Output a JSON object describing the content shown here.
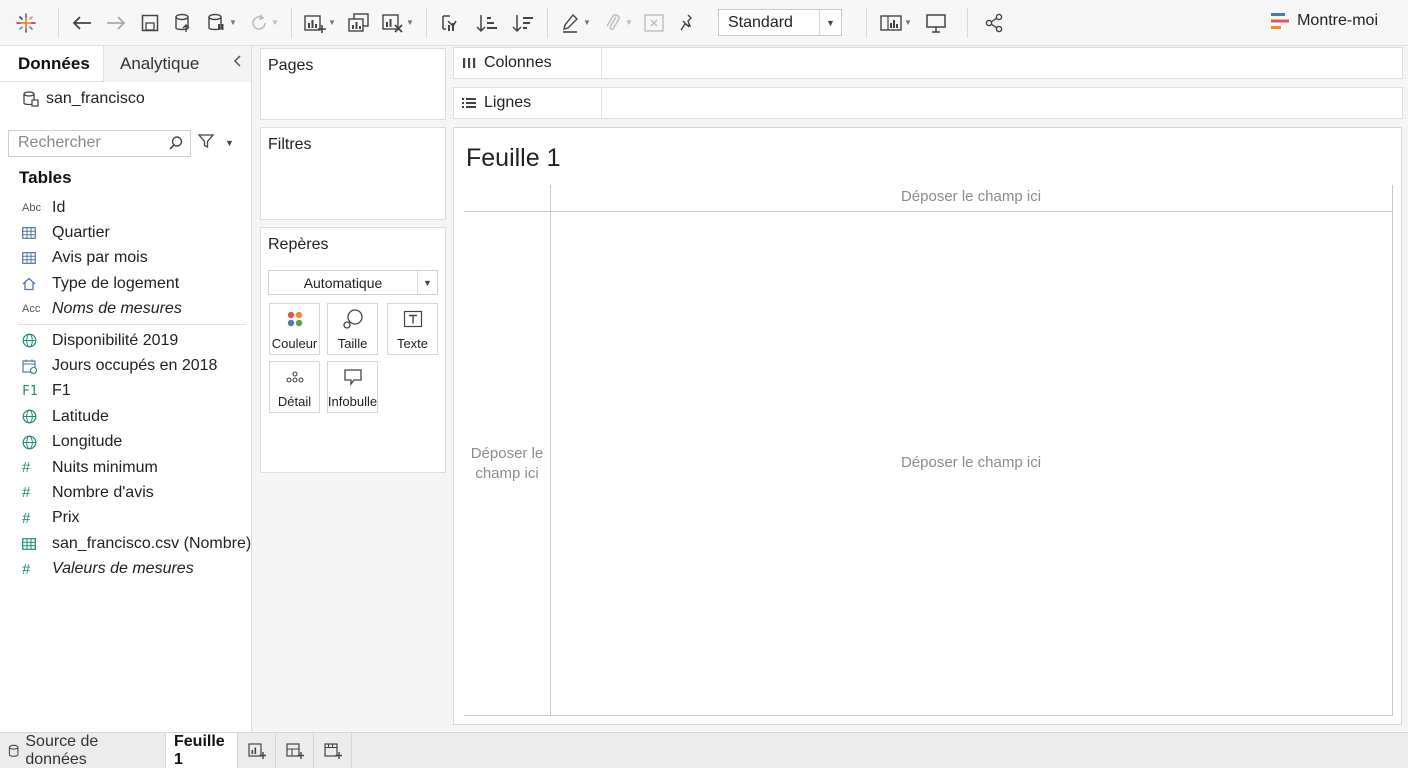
{
  "toolbar": {
    "view_select": "Standard",
    "show_me": "Montre-moi"
  },
  "data_pane": {
    "tab_data": "Données",
    "tab_analytics": "Analytique",
    "datasource": "san_francisco",
    "search_placeholder": "Rechercher",
    "tables_heading": "Tables",
    "dimensions": [
      {
        "label": "Id",
        "icon": "abc-icon"
      },
      {
        "label": "Quartier",
        "icon": "table-icon"
      },
      {
        "label": "Avis par mois",
        "icon": "table-icon"
      },
      {
        "label": "Type de logement",
        "icon": "home-icon"
      },
      {
        "label": "Noms de mesures",
        "icon": "abc-icon"
      }
    ],
    "measures": [
      {
        "label": "Disponibilité 2019",
        "icon": "globe-icon"
      },
      {
        "label": "Jours occupés en 2018",
        "icon": "calendar-icon"
      },
      {
        "label": "F1",
        "icon": "f1-icon"
      },
      {
        "label": "Latitude",
        "icon": "globe-icon"
      },
      {
        "label": "Longitude",
        "icon": "globe-icon"
      },
      {
        "label": "Nuits minimum",
        "icon": "hash-icon"
      },
      {
        "label": "Nombre d'avis",
        "icon": "hash-icon"
      },
      {
        "label": "Prix",
        "icon": "hash-icon"
      },
      {
        "label": "san_francisco.csv (Nombre)",
        "icon": "table-icon"
      },
      {
        "label": "Valeurs de mesures",
        "icon": "hash-icon"
      }
    ]
  },
  "cards": {
    "pages": "Pages",
    "filters": "Filtres",
    "marks": "Repères",
    "marks_type": "Automatique",
    "mark_buttons": {
      "color": "Couleur",
      "size": "Taille",
      "text": "Texte",
      "detail": "Détail",
      "tooltip": "Infobulle"
    }
  },
  "shelves": {
    "columns": "Colonnes",
    "rows": "Lignes"
  },
  "sheet": {
    "title": "Feuille 1",
    "drop_top": "Déposer le champ ici",
    "drop_left": "Déposer le champ ici",
    "drop_center": "Déposer le champ ici"
  },
  "bottom_tabs": {
    "datasource": "Source de données",
    "sheet1": "Feuille 1"
  }
}
